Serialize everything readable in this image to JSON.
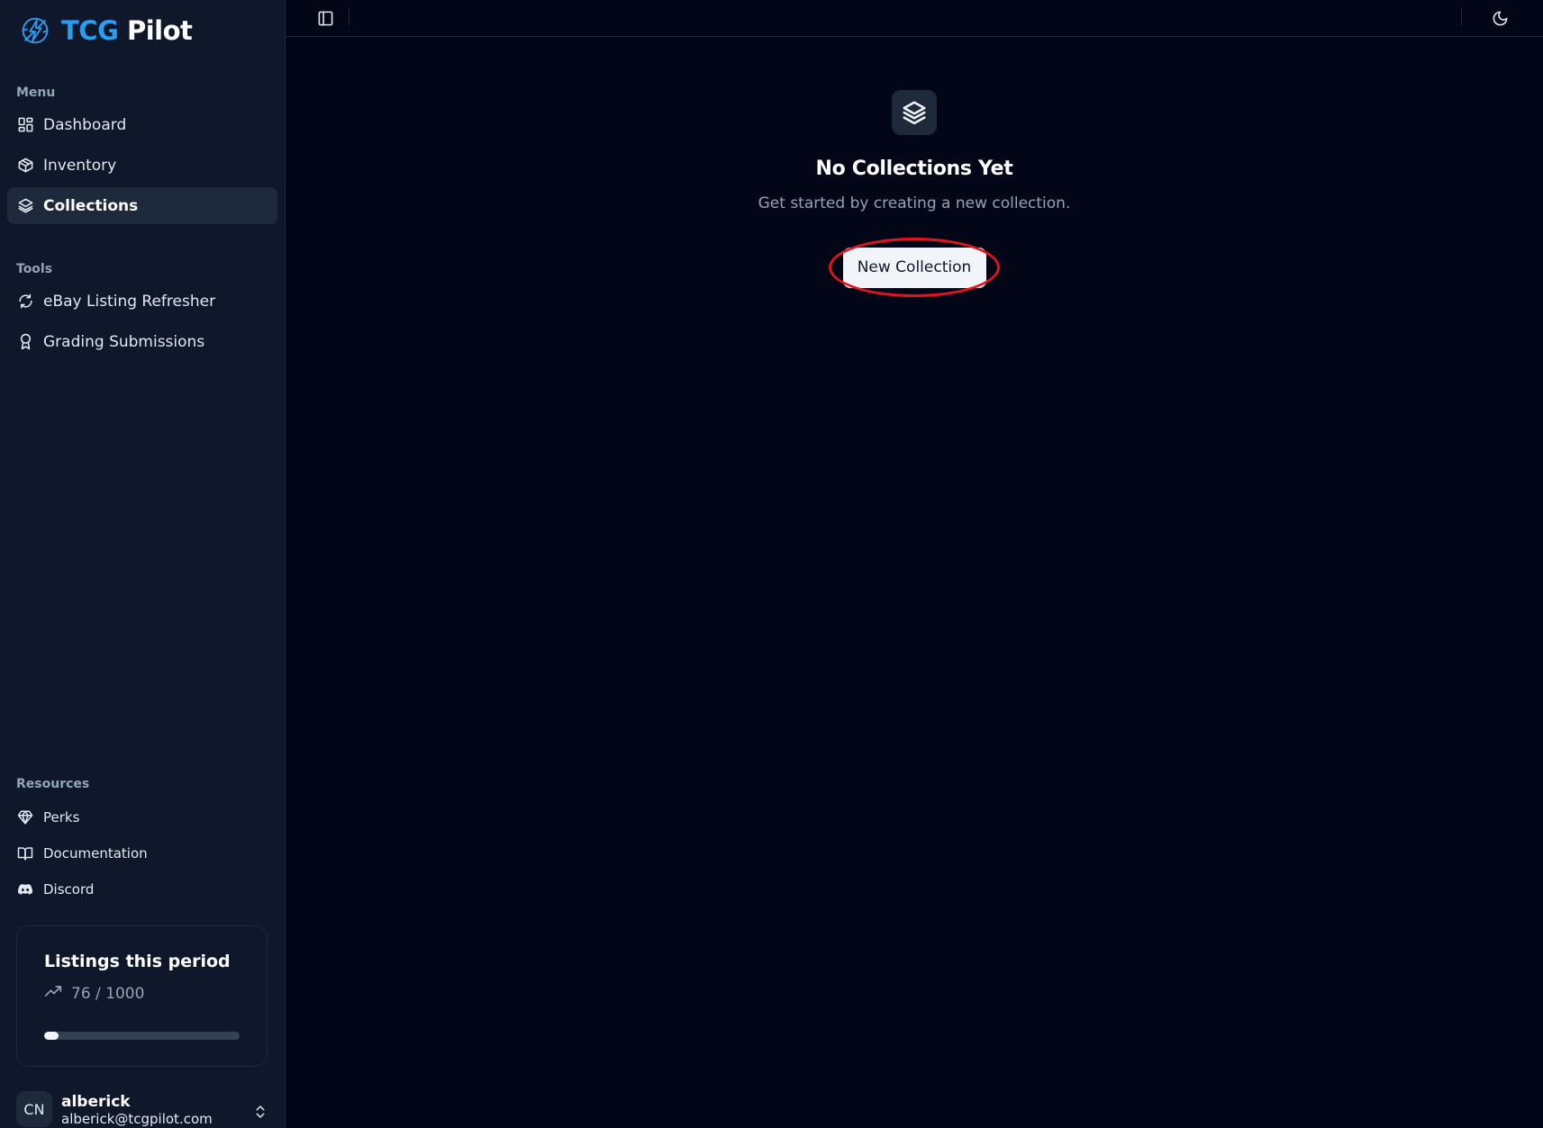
{
  "brand": {
    "part1": "TCG",
    "part2": "Pilot",
    "colors": {
      "accent": "#2a9bf0"
    }
  },
  "sidebar": {
    "menu_label": "Menu",
    "menu_items": [
      {
        "label": "Dashboard",
        "icon": "dashboard-icon"
      },
      {
        "label": "Inventory",
        "icon": "package-icon"
      },
      {
        "label": "Collections",
        "icon": "layers-icon",
        "active": true
      }
    ],
    "tools_label": "Tools",
    "tools_items": [
      {
        "label": "eBay Listing Refresher",
        "icon": "refresh-icon"
      },
      {
        "label": "Grading Submissions",
        "icon": "award-icon"
      }
    ],
    "resources_label": "Resources",
    "resources_items": [
      {
        "label": "Perks",
        "icon": "gem-icon"
      },
      {
        "label": "Documentation",
        "icon": "book-icon"
      },
      {
        "label": "Discord",
        "icon": "discord-icon"
      }
    ]
  },
  "usage": {
    "title": "Listings this period",
    "count_text": "76 / 1000",
    "used": 76,
    "limit": 1000
  },
  "user": {
    "initials": "CN",
    "name": "alberick",
    "email": "alberick@tcgpilot.com"
  },
  "main": {
    "empty_title": "No Collections Yet",
    "empty_description": "Get started by creating a new collection.",
    "new_button_label": "New Collection"
  },
  "colors": {
    "background": "#020617",
    "sidebar": "#0f172a",
    "highlight": "#e3131f"
  }
}
